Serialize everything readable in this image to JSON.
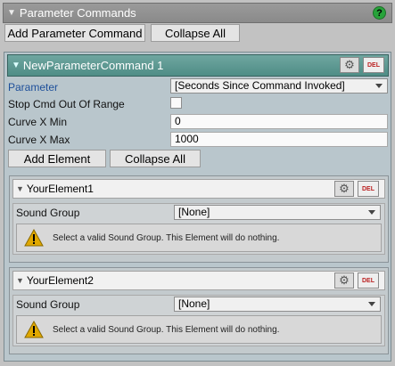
{
  "header": {
    "title": "Parameter Commands",
    "help_icon": "help-icon"
  },
  "toolbar": {
    "add_label": "Add Parameter Command",
    "collapse_label": "Collapse All"
  },
  "command": {
    "name": "NewParameterCommand 1",
    "del_label": "DEL",
    "parameter_label": "Parameter",
    "parameter_value": "[Seconds Since Command Invoked]",
    "stop_label": "Stop Cmd Out Of Range",
    "stop_checked": false,
    "curve_min_label": "Curve X Min",
    "curve_min_value": "0",
    "curve_max_label": "Curve X Max",
    "curve_max_value": "1000",
    "add_element_label": "Add Element",
    "collapse_label": "Collapse All"
  },
  "elements": [
    {
      "name": "YourElement1",
      "del_label": "DEL",
      "sound_group_label": "Sound Group",
      "sound_group_value": "[None]",
      "warning": "Select a valid Sound Group. This Element will do nothing."
    },
    {
      "name": "YourElement2",
      "del_label": "DEL",
      "sound_group_label": "Sound Group",
      "sound_group_value": "[None]",
      "warning": "Select a valid Sound Group. This Element will do nothing."
    }
  ],
  "colors": {
    "command_header": "#5b9992",
    "help_green": "#27a33a",
    "del_red": "#b22222"
  }
}
